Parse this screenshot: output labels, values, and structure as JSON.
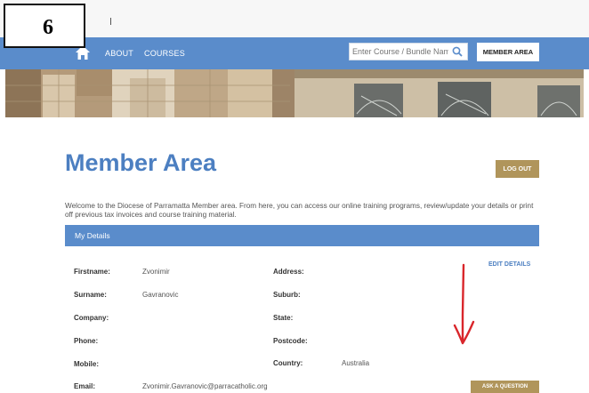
{
  "step": {
    "number": "6"
  },
  "nav": {
    "home_icon": "home-icon",
    "links": [
      "ABOUT",
      "COURSES"
    ],
    "search_placeholder": "Enter Course / Bundle Name",
    "member_area_label": "MEMBER AREA"
  },
  "page": {
    "title": "Member Area",
    "logout_label": "LOG OUT",
    "welcome": "Welcome to the Diocese of Parramatta Member area. From here, you can access our online training programs, review/update your details or print off previous tax invoices and course training material."
  },
  "details": {
    "heading": "My Details",
    "edit_label": "EDIT DETAILS",
    "ask_label": "ASK A QUESTION",
    "left": [
      {
        "label": "Firstname:",
        "value": "Zvonimir"
      },
      {
        "label": "Surname:",
        "value": "Gavranovic"
      },
      {
        "label": "Company:",
        "value": ""
      },
      {
        "label": "Phone:",
        "value": ""
      },
      {
        "label": "Mobile:",
        "value": ""
      },
      {
        "label": "Email:",
        "value": "Zvonimir.Gavranovic@parracatholic.org"
      }
    ],
    "right": [
      {
        "label": "Address:",
        "value": ""
      },
      {
        "label": "Suburb:",
        "value": ""
      },
      {
        "label": "State:",
        "value": ""
      },
      {
        "label": "Postcode:",
        "value": ""
      },
      {
        "label": "Country:",
        "value": "Australia"
      }
    ]
  },
  "colors": {
    "nav_blue": "#5a8ccb",
    "title_blue": "#4c7fc1",
    "gold_button": "#b0955b",
    "annotation_arrow": "#d9262b"
  }
}
